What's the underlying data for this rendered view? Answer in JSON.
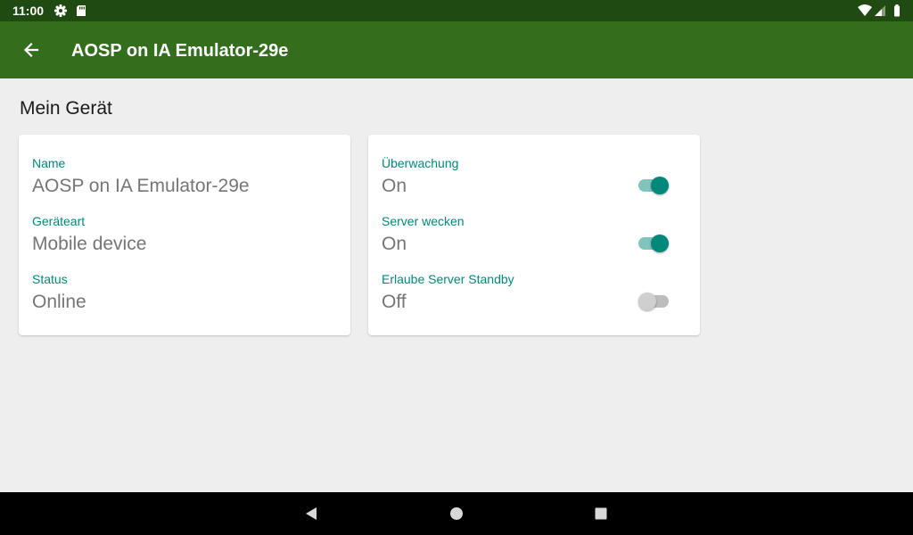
{
  "status_bar": {
    "time": "11:00",
    "icons": [
      "settings-icon",
      "sd-card-icon",
      "wifi-icon",
      "cell-signal-icon",
      "battery-icon"
    ]
  },
  "app_bar": {
    "title": "AOSP on IA Emulator-29e",
    "background": "#336e1d"
  },
  "section": {
    "title": "Mein Gerät"
  },
  "device_info": [
    {
      "label": "Name",
      "value": "AOSP on IA Emulator-29e"
    },
    {
      "label": "Geräteart",
      "value": "Mobile device"
    },
    {
      "label": "Status",
      "value": "Online"
    }
  ],
  "settings": [
    {
      "label": "Überwachung",
      "value": "On",
      "enabled": true
    },
    {
      "label": "Server wecken",
      "value": "On",
      "enabled": true
    },
    {
      "label": "Erlaube Server Standby",
      "value": "Off",
      "enabled": false
    }
  ],
  "colors": {
    "accent": "#00897b",
    "status_bar": "#1f4a12",
    "page_background": "#eeeeee"
  },
  "nav_bar": {
    "icons": [
      "back-triangle-icon",
      "home-circle-icon",
      "recents-square-icon"
    ]
  }
}
